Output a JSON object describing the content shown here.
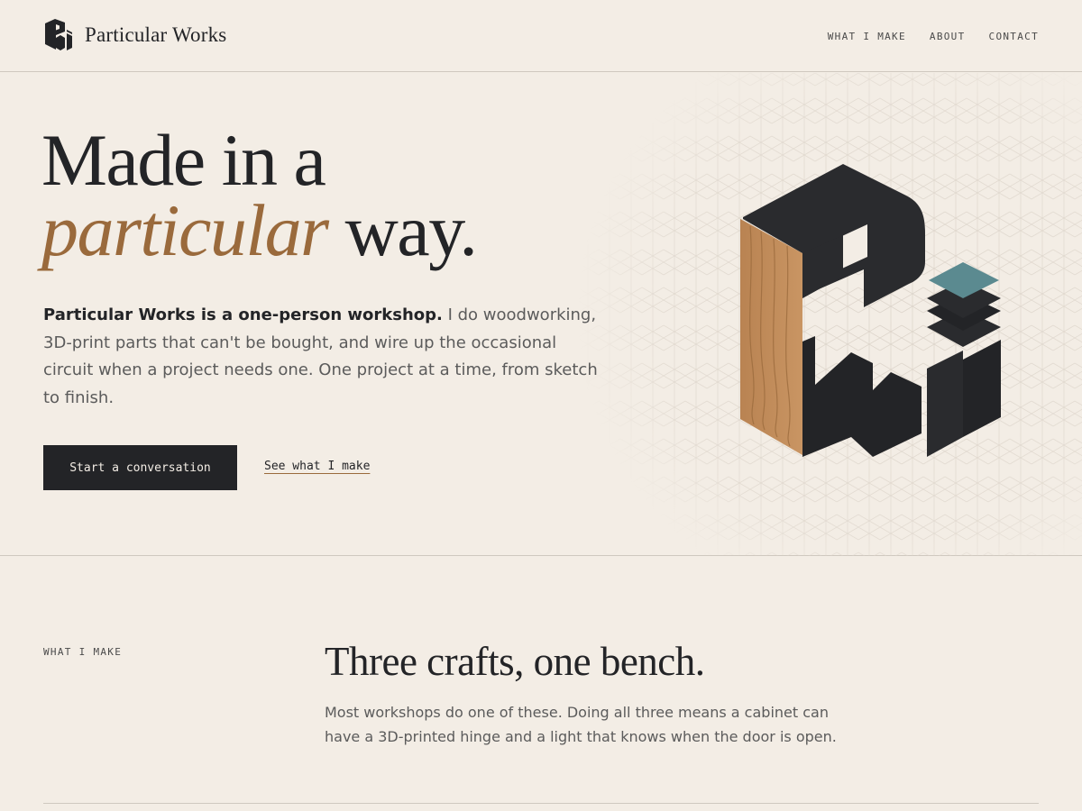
{
  "header": {
    "brand_name": "Particular Works",
    "nav": [
      {
        "label": "WHAT I MAKE"
      },
      {
        "label": "ABOUT"
      },
      {
        "label": "CONTACT"
      }
    ]
  },
  "hero": {
    "headline_line1": "Made in a",
    "headline_accent": "particular",
    "headline_rest": " way.",
    "lede_strong": "Particular Works is a one-person workshop.",
    "lede_text": " I do woodworking, 3D-print parts that can't be bought, and wire up the occasional circuit when a project needs one. One project at a time, from sketch to finish.",
    "cta_primary": "Start a conversation",
    "cta_secondary": "See what I make"
  },
  "section": {
    "label": "WHAT I MAKE",
    "title": "Three crafts, one bench.",
    "body": "Most workshops do one of these. Doing all three means a cabinet can have a 3D-printed hinge and a light that knows when the door is open."
  },
  "colors": {
    "background": "#f3ede5",
    "ink": "#232427",
    "accent_wood": "#9a6a3c",
    "accent_teal": "#5b8a90",
    "muted_text": "#5b5b5b"
  },
  "icons": {
    "brand_logo": "pw-monogram-icon",
    "hero_mark": "pw-isometric-mark-icon"
  }
}
